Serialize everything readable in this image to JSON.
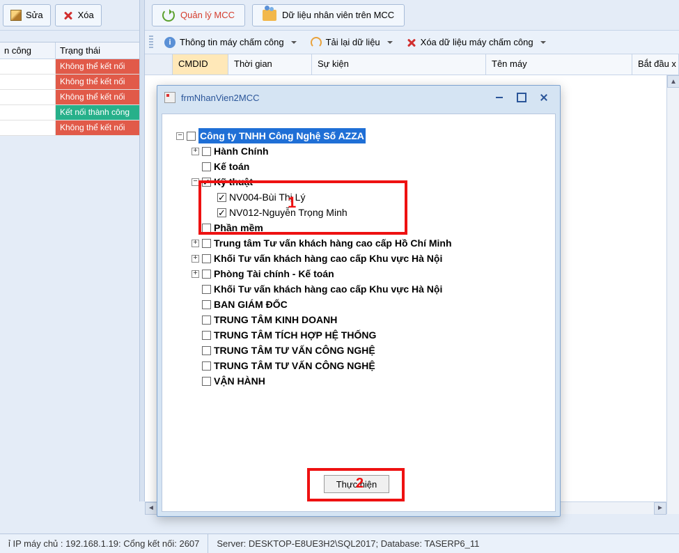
{
  "toolbar_left": {
    "edit_label": "Sửa",
    "delete_label": "Xóa"
  },
  "status_grid": {
    "col1": "n công",
    "col2": "Trạng thái",
    "rows": [
      {
        "c1": "",
        "status": "Không thể kết nối",
        "cls": "st-red"
      },
      {
        "c1": "",
        "status": "Không thể kết nối",
        "cls": "st-red"
      },
      {
        "c1": "",
        "status": "Không thể kết nối",
        "cls": "st-red"
      },
      {
        "c1": "",
        "status": "Kết nối thành công",
        "cls": "st-green"
      },
      {
        "c1": "",
        "status": "Không thể kết nối",
        "cls": "st-red"
      }
    ]
  },
  "toolbar_right1": {
    "manage_mcc": "Quản lý MCC",
    "emp_data_mcc": "Dữ liệu nhân viên trên MCC"
  },
  "toolbar_right2": {
    "device_info": "Thông tin máy chấm công",
    "reload_data": "Tải lại dữ liệu",
    "clear_data": "Xóa dữ liệu máy chấm công"
  },
  "grid_headers": {
    "cmdid": "CMDID",
    "time": "Thời gian",
    "event": "Sự kiện",
    "machine": "Tên máy",
    "start": "Bắt đầu x"
  },
  "dialog": {
    "title": "frmNhanVien2MCC",
    "exec_label": "Thực hiện",
    "tree": {
      "root": "Công ty TNHH Công Nghệ Số AZZA",
      "n1": "Hành Chính",
      "n2": "Kế toán",
      "n3": "Kỹ thuật",
      "n3a": "NV004-Bùi Thị Lý",
      "n3b": "NV012-Nguyễn Trọng Minh",
      "n4": "Phần mềm",
      "n5": "Trung tâm Tư vấn khách hàng cao cấp Hồ Chí Minh",
      "n6": "Khối Tư vấn khách hàng cao cấp Khu vực Hà Nội",
      "n7": "Phòng Tài chính - Kế toán",
      "n8": "Khối Tư vấn khách hàng cao cấp Khu vực Hà Nội",
      "n9": "BAN GIÁM ĐỐC",
      "n10": "TRUNG TÂM KINH DOANH",
      "n11": "TRUNG TÂM TÍCH HỢP HỆ THỐNG",
      "n12": "TRUNG TÂM TƯ VẤN CÔNG NGHỆ",
      "n13": "TRUNG TÂM TƯ VẤN CÔNG NGHỆ",
      "n14": "VẬN HÀNH"
    }
  },
  "statusbar": {
    "left": "ỉ IP máy chủ : 192.168.1.19: Cổng kết nối: 2607",
    "right": "Server: DESKTOP-E8UE3H2\\SQL2017; Database: TASERP6_11"
  },
  "annotations": {
    "one": "1",
    "two": "2"
  }
}
